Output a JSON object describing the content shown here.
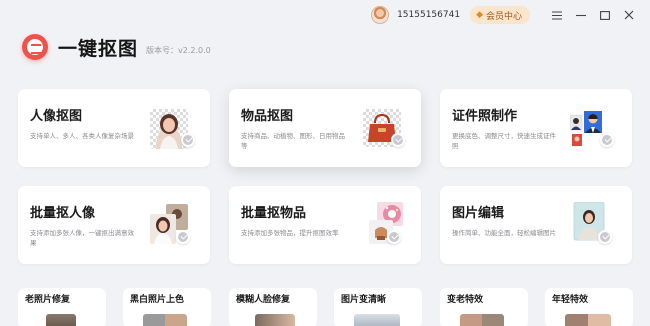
{
  "header": {
    "phone": "15155156741",
    "vip_label": "会员中心",
    "menu_icon": "menu-icon",
    "minimize_icon": "minimize-icon",
    "maximize_icon": "maximize-icon",
    "close_icon": "close-icon"
  },
  "brand": {
    "app_name": "一键抠图",
    "version": "版本号：v2.2.0.0",
    "logo_icon": "camera-logo-icon",
    "accent_color": "#f0524a"
  },
  "cards": [
    {
      "title": "人像抠图",
      "desc": "支持单人、多人、各类人像复杂场景"
    },
    {
      "title": "物品抠图",
      "desc": "支持商品、动植物、图形、日用物品等"
    },
    {
      "title": "证件照制作",
      "desc": "更换底色、调整尺寸，快速生成证件照"
    },
    {
      "title": "批量抠人像",
      "desc": "支持添加多张人像，一键抠出满意效果"
    },
    {
      "title": "批量抠物品",
      "desc": "支持添加多张物品，提升抠图效率"
    },
    {
      "title": "图片编辑",
      "desc": "操作简单、功能全面，轻松编辑图片"
    }
  ],
  "tools": [
    {
      "title": "老照片修复"
    },
    {
      "title": "黑白照片上色"
    },
    {
      "title": "模糊人脸修复"
    },
    {
      "title": "图片变清晰"
    },
    {
      "title": "变老特效"
    },
    {
      "title": "年轻特效"
    }
  ]
}
